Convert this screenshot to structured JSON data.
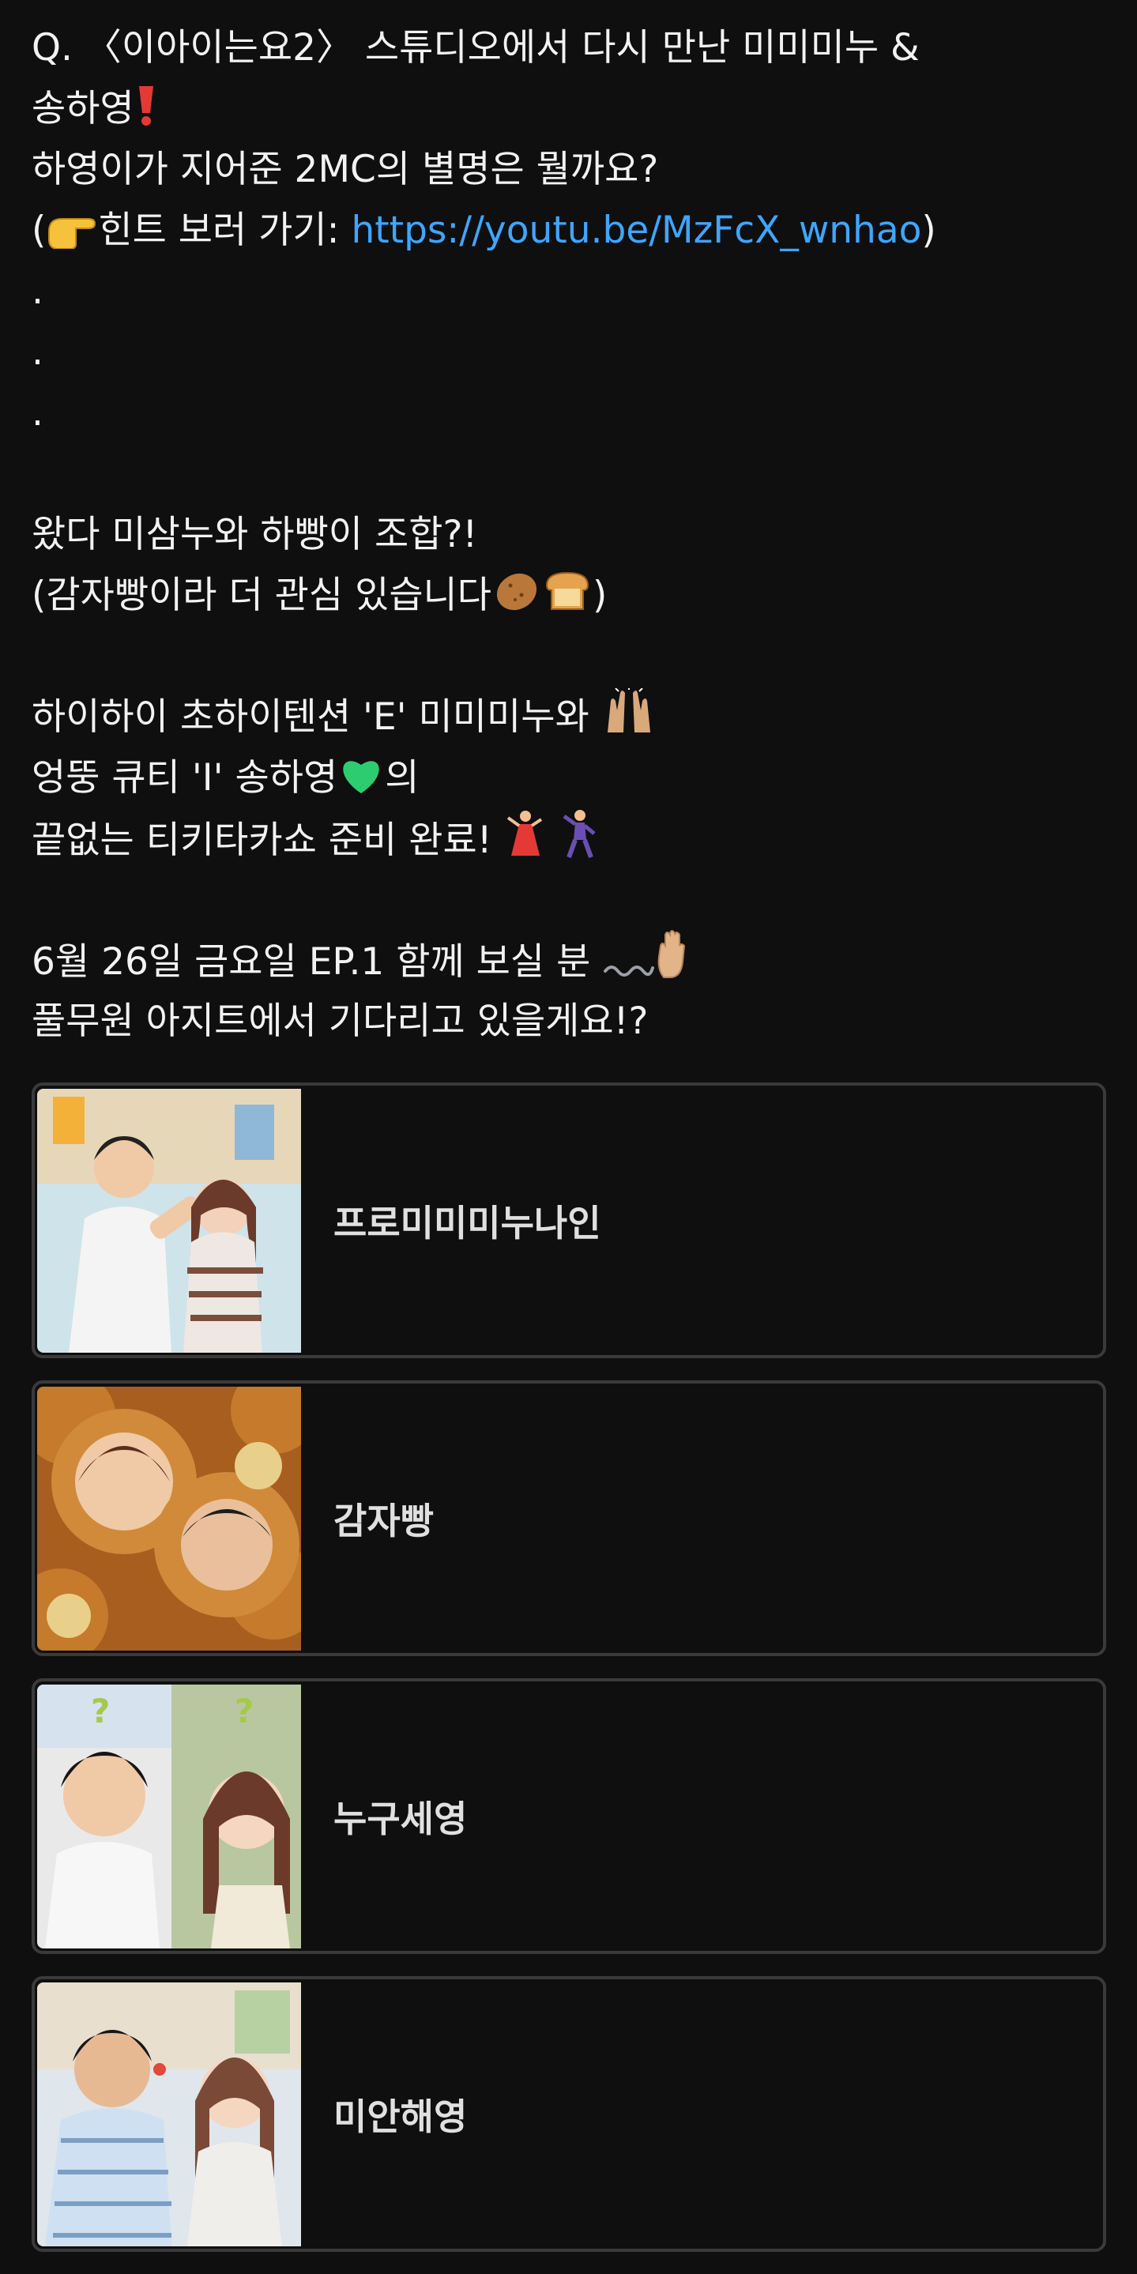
{
  "post": {
    "lines": [
      {
        "segments": [
          {
            "text": "Q. 〈이아이는요2〉 스튜디오에서 다시 만난 미미미누 &"
          }
        ]
      },
      {
        "segments": [
          {
            "text": "송하영"
          },
          {
            "emoji": "exclamation-icon"
          }
        ]
      },
      {
        "segments": [
          {
            "text": "하영이가 지어준 2MC의 별명은 뭘까요?"
          }
        ]
      },
      {
        "segments": [
          {
            "text": "("
          },
          {
            "emoji": "pointing-hand-icon"
          },
          {
            "text": "힌트 보러 가기: "
          },
          {
            "link": "https://youtu.be/MzFcX_wnhao"
          },
          {
            "text": ")"
          }
        ]
      },
      {
        "segments": [
          {
            "text": "."
          }
        ]
      },
      {
        "segments": [
          {
            "text": "."
          }
        ]
      },
      {
        "segments": [
          {
            "text": "."
          }
        ]
      },
      {
        "blank": true
      },
      {
        "segments": [
          {
            "text": "왔다 미삼누와 하빵이 조합?!"
          }
        ]
      },
      {
        "segments": [
          {
            "text": "(감자빵이라 더 관심 있습니다"
          },
          {
            "emoji": "potato-icon"
          },
          {
            "emoji": "bread-icon"
          },
          {
            "text": ")"
          }
        ]
      },
      {
        "blank": true
      },
      {
        "segments": [
          {
            "text": "하이하이 초하이텐션 'E' 미미미누와 "
          },
          {
            "emoji": "raised-hands-icon"
          }
        ]
      },
      {
        "segments": [
          {
            "text": "엉뚱 큐티 'I' 송하영"
          },
          {
            "emoji": "green-heart-icon"
          },
          {
            "text": "의"
          }
        ]
      },
      {
        "segments": [
          {
            "text": "끝없는 티키타카쇼 준비 완료! "
          },
          {
            "emoji": "dancer-icon"
          },
          {
            "text": " "
          },
          {
            "emoji": "man-dancing-icon"
          }
        ]
      },
      {
        "blank": true
      },
      {
        "segments": [
          {
            "text": "6월 26일 금요일 EP.1 함께 보실 분 "
          },
          {
            "emoji": "wavy-dash-icon"
          },
          {
            "emoji": "raised-hand-icon"
          }
        ]
      },
      {
        "segments": [
          {
            "text": "풀무원 아지트에서 기다리고 있을게요!?"
          }
        ]
      }
    ]
  },
  "poll": {
    "options": [
      {
        "label": "프로미미미누나인",
        "thumb": "photo-duo-studio"
      },
      {
        "label": "감자빵",
        "thumb": "potato-bread-faces"
      },
      {
        "label": "누구세영",
        "thumb": "photo-duo-question"
      },
      {
        "label": "미안해영",
        "thumb": "photo-duo-apology"
      }
    ]
  },
  "colors": {
    "background": "#0f0f0f",
    "text": "#f2f2f2",
    "link": "#3ea6ff",
    "border": "#3a3a3a"
  }
}
